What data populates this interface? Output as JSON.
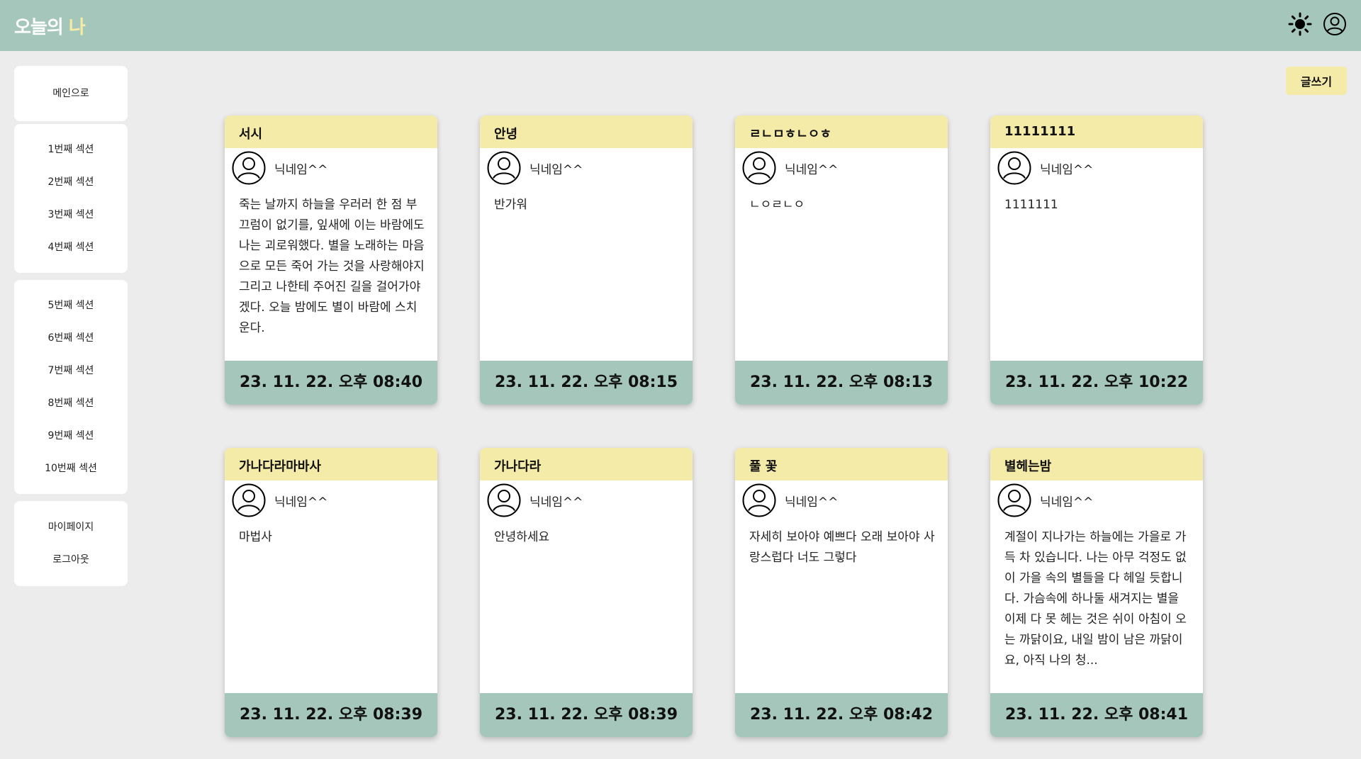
{
  "header": {
    "logo_part1": "오늘의",
    "logo_part2": "나",
    "theme_icon": "sun-icon",
    "profile_icon": "user-circle-icon"
  },
  "sidebar": {
    "group1": [
      "메인으로"
    ],
    "group2": [
      "1번째 섹션",
      "2번째 섹션",
      "3번째 섹션",
      "4번째 섹션"
    ],
    "group3": [
      "5번째 섹션",
      "6번째 섹션",
      "7번째 섹션",
      "8번째 섹션",
      "9번째 섹션",
      "10번째 섹션"
    ],
    "group4": [
      "마이페이지",
      "로그아웃"
    ]
  },
  "write_button": "글쓰기",
  "cards": [
    {
      "title": "서시",
      "nickname": "닉네임^^",
      "content": "죽는 날까지 하늘을 우러러 한 점 부끄럼이 없기를, 잎새에 이는 바람에도 나는 괴로워했다. 별을 노래하는 마음으로 모든 죽어 가는 것을 사랑해야지 그리고 나한테 주어진 길을 걸어가야겠다. 오늘 밤에도 별이 바람에 스치운다.",
      "date": "23. 11. 22. 오후 08:40"
    },
    {
      "title": "안녕",
      "nickname": "닉네임^^",
      "content": "반가워",
      "date": "23. 11. 22. 오후 08:15"
    },
    {
      "title": "ㄹㄴㅁㅎㄴㅇㅎ",
      "nickname": "닉네임^^",
      "content": "ㄴㅇㄹㄴㅇ",
      "date": "23. 11. 22. 오후 08:13"
    },
    {
      "title": "11111111",
      "nickname": "닉네임^^",
      "content": "1111111",
      "date": "23. 11. 22. 오후 10:22"
    },
    {
      "title": "가나다라마바사",
      "nickname": "닉네임^^",
      "content": "마법사",
      "date": "23. 11. 22. 오후 08:39"
    },
    {
      "title": "가나다라",
      "nickname": "닉네임^^",
      "content": "안녕하세요",
      "date": "23. 11. 22. 오후 08:39"
    },
    {
      "title": "풀 꽃",
      "nickname": "닉네임^^",
      "content": "자세히 보아야 예쁘다 오래 보아야 사랑스럽다 너도 그렇다",
      "date": "23. 11. 22. 오후 08:42"
    },
    {
      "title": "별헤는밤",
      "nickname": "닉네임^^",
      "content": "계절이 지나가는 하늘에는 가을로 가득 차 있습니다. 나는 아무 걱정도 없이 가을 속의 별들을 다 헤일 듯합니다. 가슴속에 하나둘 새겨지는 별을 이제 다 못 헤는 것은 쉬이 아침이 오는 까닭이요, 내일 밤이 남은 까닭이요, 아직 나의 청...",
      "date": "23. 11. 22. 오후 08:41"
    }
  ]
}
